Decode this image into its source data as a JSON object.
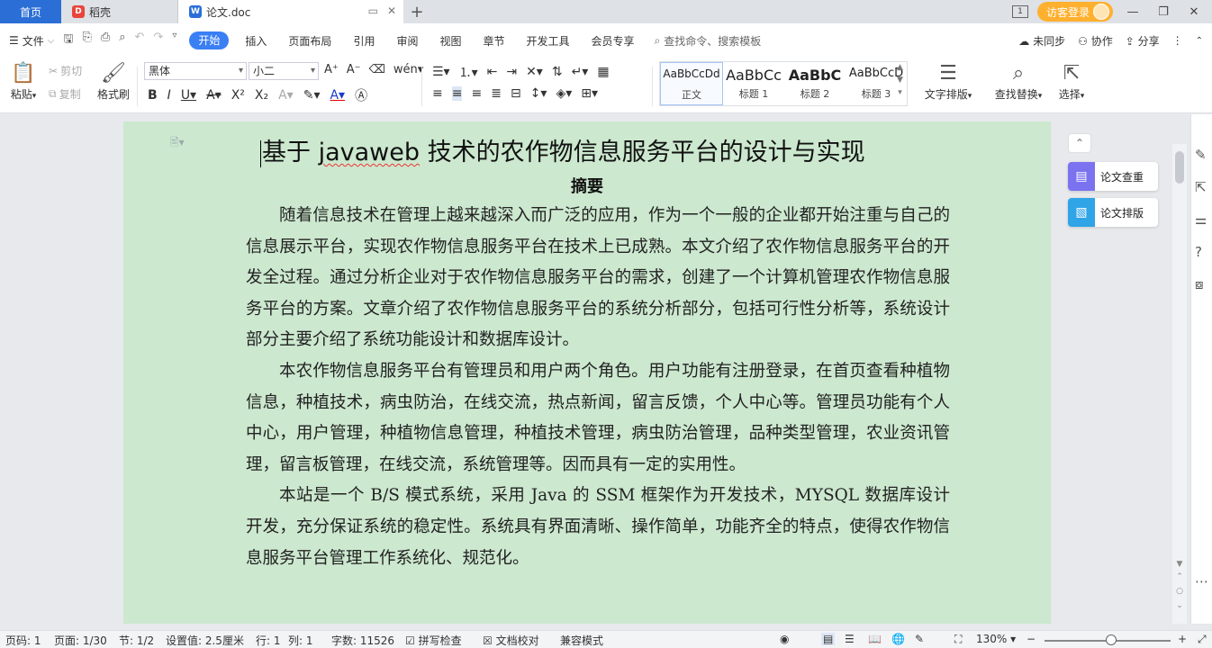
{
  "tabs": {
    "home": "首页",
    "daoke": "稻壳",
    "doc": "论文.doc",
    "visitor_login": "访客登录",
    "win_num": "1"
  },
  "menu": {
    "file": "文件",
    "tabs": [
      "开始",
      "插入",
      "页面布局",
      "引用",
      "审阅",
      "视图",
      "章节",
      "开发工具",
      "会员专享"
    ],
    "search": "查找命令、搜索模板",
    "sync": "未同步",
    "collab": "协作",
    "share": "分享"
  },
  "ribbon": {
    "paste": "粘贴",
    "cut": "剪切",
    "copy": "复制",
    "format_painter": "格式刷",
    "font_name": "黑体",
    "font_size": "小二",
    "styles": [
      {
        "sample": "AaBbCcDd",
        "name": "正文"
      },
      {
        "sample": "AaBbCc",
        "name": "标题 1"
      },
      {
        "sample": "AaBbC",
        "name": "标题 2"
      },
      {
        "sample": "AaBbCcD",
        "name": "标题 3"
      }
    ],
    "text_layout": "文字排版",
    "find_replace": "查找替换",
    "select": "选择"
  },
  "document": {
    "title_pre": "基于 ",
    "title_word": "javaweb",
    "title_post": " 技术的农作物信息服务平台的设计与实现",
    "abstract_heading": "摘要",
    "paragraphs": [
      "随着信息技术在管理上越来越深入而广泛的应用，作为一个一般的企业都开始注重与自己的信息展示平台，实现农作物信息服务平台在技术上已成熟。本文介绍了农作物信息服务平台的开发全过程。通过分析企业对于农作物信息服务平台的需求，创建了一个计算机管理农作物信息服务平台的方案。文章介绍了农作物信息服务平台的系统分析部分，包括可行性分析等，系统设计部分主要介绍了系统功能设计和数据库设计。",
      "本农作物信息服务平台有管理员和用户两个角色。用户功能有注册登录，在首页查看种植物信息，种植技术，病虫防治，在线交流，热点新闻，留言反馈，个人中心等。管理员功能有个人中心，用户管理，种植物信息管理，种植技术管理，病虫防治管理，品种类型管理，农业资讯管理，留言板管理，在线交流，系统管理等。因而具有一定的实用性。",
      "本站是一个 B/S 模式系统，采用 Java 的 SSM 框架作为开发技术，MYSQL 数据库设计开发，充分保证系统的稳定性。系统具有界面清晰、操作简单，功能齐全的特点，使得农作物信息服务平台管理工作系统化、规范化。"
    ]
  },
  "side_tools": {
    "plagiarism": "论文查重",
    "layout": "论文排版"
  },
  "status": {
    "page_no": "页码: 1",
    "pages": "页面: 1/30",
    "section": "节: 1/2",
    "setting": "设置值: 2.5厘米",
    "row": "行: 1",
    "col": "列: 1",
    "words": "字数: 11526",
    "spell": "拼写检查",
    "proof": "文档校对",
    "compat": "兼容模式",
    "zoom": "130%"
  },
  "colors": {
    "accent": "#3a7ff4",
    "home_tab": "#2b6fd6",
    "visitor": "#ffb02e",
    "page_bg": "#cce8cf"
  }
}
